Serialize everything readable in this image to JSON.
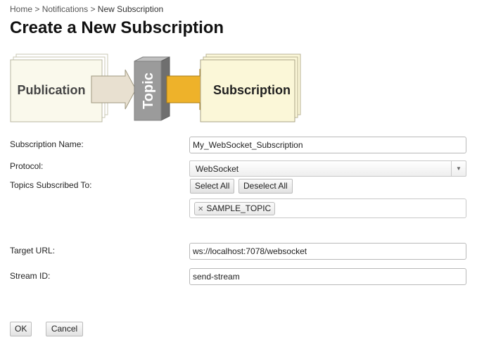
{
  "breadcrumb": {
    "home": "Home",
    "separator": ">",
    "notifications": "Notifications",
    "current": "New Subscription"
  },
  "page": {
    "title": "Create a New Subscription"
  },
  "diagram": {
    "publication": "Publication",
    "topic": "Topic",
    "subscription": "Subscription",
    "colors": {
      "card_fill": "#faf9ec",
      "arrow1_fill": "#e8e0d0",
      "topic_fill": "#9b9b9b",
      "arrow2_fill": "#eeb22a",
      "subscription_fill": "#fbf7d8"
    }
  },
  "form": {
    "subscription_name": {
      "label": "Subscription Name:",
      "value": "My_WebSocket_Subscription"
    },
    "protocol": {
      "label": "Protocol:",
      "value": "WebSocket"
    },
    "topics": {
      "label": "Topics Subscribed To:",
      "select_all": "Select All",
      "deselect_all": "Deselect All",
      "tags": [
        "SAMPLE_TOPIC"
      ]
    },
    "target_url": {
      "label": "Target URL:",
      "value": "ws://localhost:7078/websocket"
    },
    "stream_id": {
      "label": "Stream ID:",
      "value": "send-stream"
    }
  },
  "actions": {
    "ok": "OK",
    "cancel": "Cancel"
  }
}
